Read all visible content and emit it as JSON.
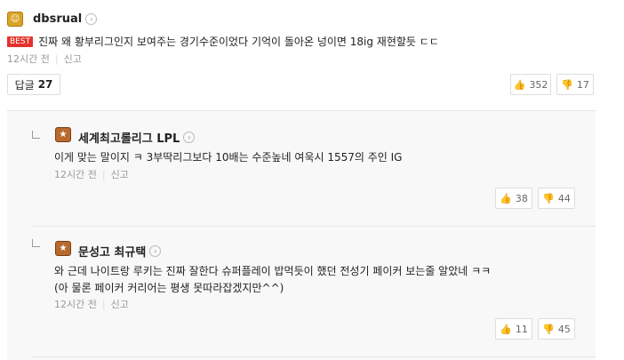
{
  "best_comment": {
    "username": "dbsrual",
    "best_label": "BEST",
    "text": "진짜 왜 황부리그인지 보여주는 경기수준이었다 기억이 돌아온 넝이면 18ig 재현할듯 ㄷㄷ",
    "time": "12시간 전",
    "report_label": "신고",
    "reply_label": "답글",
    "reply_count": "27",
    "like_count": "352",
    "dislike_count": "17"
  },
  "replies": [
    {
      "username": "세계최고롤리그 LPL",
      "text": "이게 맞는 말이지 ㅋ 3부딱리그보다 10배는 수준높네 여욱시 1557의 주인 IG",
      "time": "12시간 전",
      "report_label": "신고",
      "like_count": "38",
      "dislike_count": "44"
    },
    {
      "username": "문성고 최규택",
      "text_line1": "와 근데 나이트랑 루키는 진짜 잘한다 슈퍼플레이 밥먹듯이 했던 전성기 페이커 보는줄 알았네 ㅋㅋ",
      "text_line2": "(아 물론 페이커 커리어는 평생 못따라잡겠지만^^)",
      "time": "12시간 전",
      "report_label": "신고",
      "like_count": "11",
      "dislike_count": "45"
    }
  ],
  "icons": {
    "user_badge": "badge-icon",
    "chevron": "chevron-right-icon",
    "like": "thumbs-up-icon",
    "dislike": "thumbs-down-icon"
  },
  "colors": {
    "best_badge": "#e4322c",
    "reply_background": "#f8f8f8"
  }
}
